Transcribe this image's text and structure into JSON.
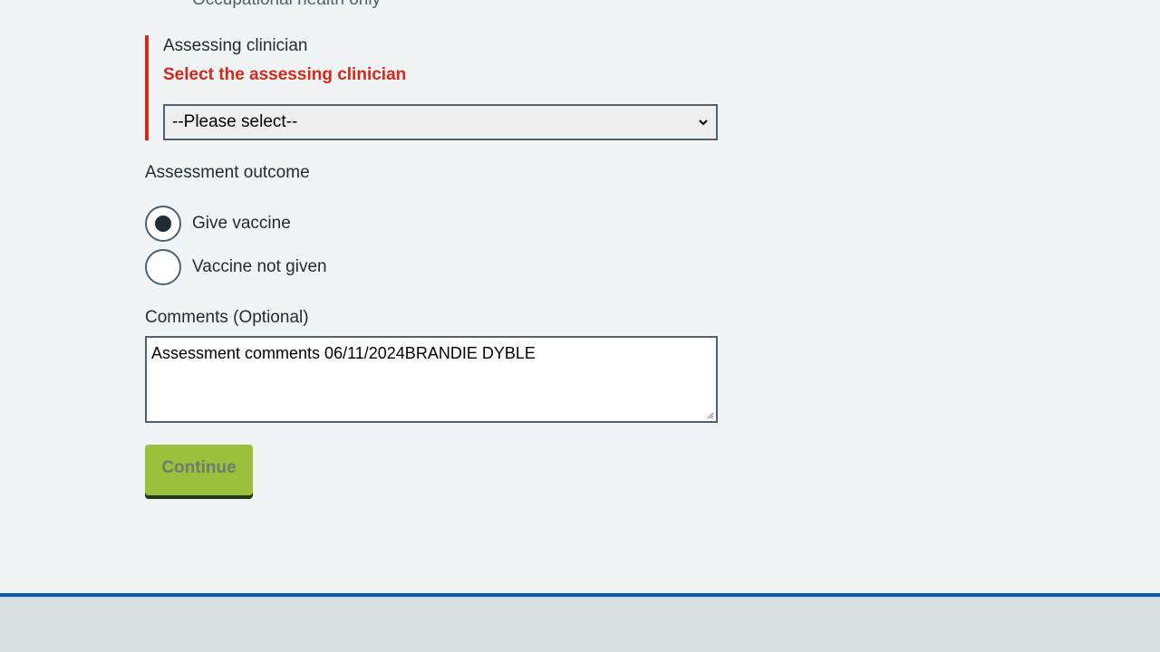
{
  "form": {
    "previous_option_label": "Occupational health only",
    "assessing_clinician": {
      "label": "Assessing clinician",
      "error": "Select the assessing clinician",
      "selected_value": "--Please select--"
    },
    "assessment_outcome": {
      "label": "Assessment outcome",
      "options": [
        {
          "label": "Give vaccine",
          "checked": true
        },
        {
          "label": "Vaccine not given",
          "checked": false
        }
      ]
    },
    "comments": {
      "label": "Comments (Optional)",
      "value": "Assessment comments 06/11/2024BRANDIE DYBLE"
    },
    "continue_label": "Continue"
  },
  "icons": {
    "select_arrow": "chevron-down-icon",
    "textarea_grip": "resize-grip-icon"
  },
  "colors": {
    "error": "#d5281b",
    "footer_rule": "#005eb8",
    "button": "#9bc03c"
  }
}
